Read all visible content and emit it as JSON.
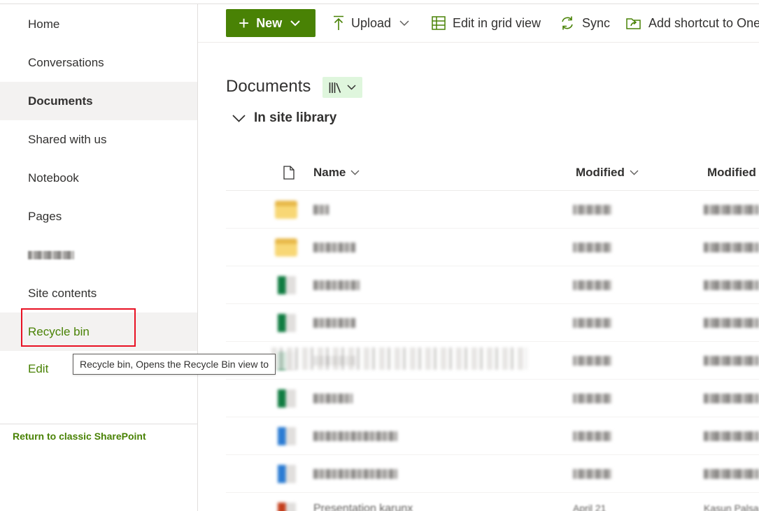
{
  "nav": {
    "items": [
      {
        "label": "Home"
      },
      {
        "label": "Conversations"
      },
      {
        "label": "Documents"
      },
      {
        "label": "Shared with us"
      },
      {
        "label": "Notebook"
      },
      {
        "label": "Pages"
      },
      {
        "label": ""
      },
      {
        "label": "Site contents"
      },
      {
        "label": "Recycle bin"
      },
      {
        "label": "Edit"
      }
    ],
    "classic_link": "Return to classic SharePoint"
  },
  "tooltip": "Recycle bin, Opens the Recycle Bin view to",
  "commandbar": {
    "new": "New",
    "upload": "Upload",
    "grid": "Edit in grid view",
    "sync": "Sync",
    "shortcut": "Add shortcut to One"
  },
  "library": {
    "title": "Documents",
    "group": "In site library"
  },
  "columns": {
    "name": "Name",
    "modified": "Modified",
    "modified_by": "Modified"
  },
  "rows": [
    {
      "kind": "folder",
      "name": "",
      "modified": "",
      "by": ""
    },
    {
      "kind": "folder",
      "name": "",
      "modified": "",
      "by": ""
    },
    {
      "kind": "excel",
      "name": "",
      "modified": "",
      "by": ""
    },
    {
      "kind": "excel",
      "name": "",
      "modified": "",
      "by": ""
    },
    {
      "kind": "excel",
      "name": "",
      "modified": "",
      "by": ""
    },
    {
      "kind": "excel",
      "name": "",
      "modified": "",
      "by": ""
    },
    {
      "kind": "word",
      "name": "",
      "modified": "",
      "by": ""
    },
    {
      "kind": "word",
      "name": "",
      "modified": "",
      "by": ""
    },
    {
      "kind": "ppt",
      "name": "Presentation karunx",
      "modified": "April 21",
      "by": "Kasun Palsa"
    }
  ],
  "colors": {
    "accent": "#498205",
    "accent_light": "#dff6dd",
    "focus": "#e81123",
    "folder": "#f8d775",
    "excel": "#107c41",
    "word": "#2b7cd3",
    "ppt": "#c43e1c"
  }
}
